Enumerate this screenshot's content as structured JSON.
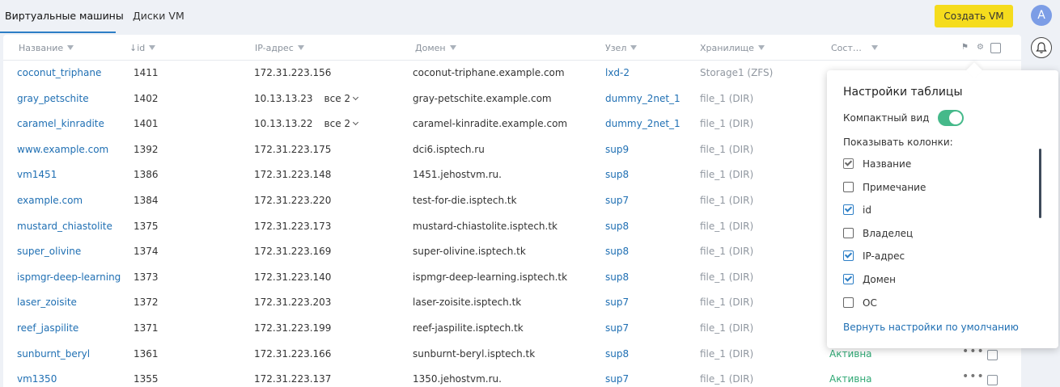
{
  "tabs": [
    {
      "label": "Виртуальные машины"
    },
    {
      "label": "Диски VM"
    }
  ],
  "create_button": "Создать VM",
  "columns": {
    "name": "Название",
    "id": "↓id",
    "ip": "IP-адрес",
    "domain": "Домен",
    "node": "Узел",
    "storage": "Хранилище",
    "status": "Сост…"
  },
  "rows": [
    {
      "name": "coconut_triphane",
      "id": "1411",
      "ip": "172.31.223.156",
      "ip_more": "",
      "domain": "coconut-triphane.example.com",
      "node": "lxd-2",
      "storage": "Storage1 (ZFS)",
      "status": ""
    },
    {
      "name": "gray_petschite",
      "id": "1402",
      "ip": "10.13.13.23",
      "ip_more": "все 2",
      "domain": "gray-petschite.example.com",
      "node": "dummy_2net_1",
      "storage": "file_1 (DIR)",
      "status": ""
    },
    {
      "name": "caramel_kinradite",
      "id": "1401",
      "ip": "10.13.13.22",
      "ip_more": "все 2",
      "domain": "caramel-kinradite.example.com",
      "node": "dummy_2net_1",
      "storage": "file_1 (DIR)",
      "status": ""
    },
    {
      "name": "www.example.com",
      "id": "1392",
      "ip": "172.31.223.175",
      "ip_more": "",
      "domain": "dci6.isptech.ru",
      "node": "sup9",
      "storage": "file_1 (DIR)",
      "status": ""
    },
    {
      "name": "vm1451",
      "id": "1386",
      "ip": "172.31.223.148",
      "ip_more": "",
      "domain": "1451.jehostvm.ru.",
      "node": "sup8",
      "storage": "file_1 (DIR)",
      "status": ""
    },
    {
      "name": "example.com",
      "id": "1384",
      "ip": "172.31.223.220",
      "ip_more": "",
      "domain": "test-for-die.isptech.tk",
      "node": "sup7",
      "storage": "file_1 (DIR)",
      "status": ""
    },
    {
      "name": "mustard_chiastolite",
      "id": "1375",
      "ip": "172.31.223.173",
      "ip_more": "",
      "domain": "mustard-chiastolite.isptech.tk",
      "node": "sup8",
      "storage": "file_1 (DIR)",
      "status": ""
    },
    {
      "name": "super_olivine",
      "id": "1374",
      "ip": "172.31.223.169",
      "ip_more": "",
      "domain": "super-olivine.isptech.tk",
      "node": "sup8",
      "storage": "file_1 (DIR)",
      "status": ""
    },
    {
      "name": "ispmgr-deep-learning",
      "id": "1373",
      "ip": "172.31.223.140",
      "ip_more": "",
      "domain": "ispmgr-deep-learning.isptech.tk",
      "node": "sup8",
      "storage": "file_1 (DIR)",
      "status": ""
    },
    {
      "name": "laser_zoisite",
      "id": "1372",
      "ip": "172.31.223.203",
      "ip_more": "",
      "domain": "laser-zoisite.isptech.tk",
      "node": "sup7",
      "storage": "file_1 (DIR)",
      "status": ""
    },
    {
      "name": "reef_jaspilite",
      "id": "1371",
      "ip": "172.31.223.199",
      "ip_more": "",
      "domain": "reef-jaspilite.isptech.tk",
      "node": "sup7",
      "storage": "file_1 (DIR)",
      "status": ""
    },
    {
      "name": "sunburnt_beryl",
      "id": "1361",
      "ip": "172.31.223.166",
      "ip_more": "",
      "domain": "sunburnt-beryl.isptech.tk",
      "node": "sup8",
      "storage": "file_1 (DIR)",
      "status": "Активна"
    },
    {
      "name": "vm1350",
      "id": "1355",
      "ip": "172.31.223.137",
      "ip_more": "",
      "domain": "1350.jehostvm.ru.",
      "node": "sup7",
      "storage": "file_1 (DIR)",
      "status": "Активна"
    }
  ],
  "user": {
    "avatar_letter": "A"
  },
  "settings_popup": {
    "title": "Настройки таблицы",
    "compact_label": "Компактный вид",
    "compact_on": true,
    "show_columns_label": "Показывать колонки:",
    "options": [
      {
        "label": "Название",
        "checked": true,
        "locked": true
      },
      {
        "label": "Примечание",
        "checked": false
      },
      {
        "label": "id",
        "checked": true
      },
      {
        "label": "Владелец",
        "checked": false
      },
      {
        "label": "IP-адрес",
        "checked": true
      },
      {
        "label": "Домен",
        "checked": true
      },
      {
        "label": "ОС",
        "checked": false
      }
    ],
    "reset_label": "Вернуть настройки по умолчанию"
  },
  "colors": {
    "accent": "#2c7ec6",
    "link": "#1f6fb3",
    "create": "#f5dc1d",
    "status_active": "#2fa874",
    "toggle": "#45b98a"
  }
}
